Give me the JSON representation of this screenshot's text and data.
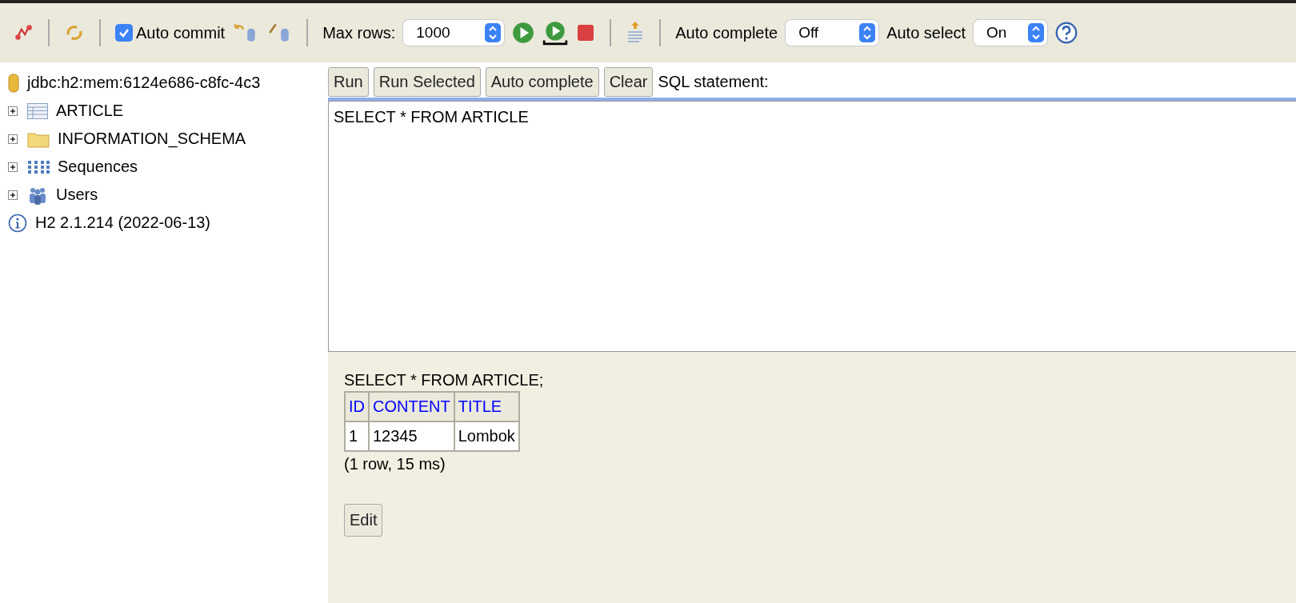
{
  "toolbar": {
    "auto_commit": {
      "label": "Auto commit",
      "checked": true
    },
    "max_rows": {
      "label": "Max rows:",
      "value": "1000"
    },
    "auto_complete": {
      "label": "Auto complete",
      "value": "Off"
    },
    "auto_select": {
      "label": "Auto select",
      "value": "On"
    }
  },
  "sidebar": {
    "connection": "jdbc:h2:mem:6124e686-c8fc-4c3",
    "items": [
      {
        "label": "ARTICLE",
        "kind": "table",
        "expanded": false
      },
      {
        "label": "INFORMATION_SCHEMA",
        "kind": "folder",
        "expanded": false
      },
      {
        "label": "Sequences",
        "kind": "sequences",
        "expanded": false
      },
      {
        "label": "Users",
        "kind": "users",
        "expanded": false
      }
    ],
    "version": "H2 2.1.214 (2022-06-13)"
  },
  "editor": {
    "buttons": [
      "Run",
      "Run Selected",
      "Auto complete",
      "Clear"
    ],
    "label": "SQL statement:",
    "value": "SELECT * FROM ARTICLE"
  },
  "result": {
    "statement": "SELECT * FROM ARTICLE;",
    "table": {
      "columns": [
        "ID",
        "CONTENT",
        "TITLE"
      ],
      "rows": [
        [
          "1",
          "12345",
          "Lombok"
        ]
      ]
    },
    "summary": "(1 row, 15 ms)",
    "button": "Edit"
  }
}
